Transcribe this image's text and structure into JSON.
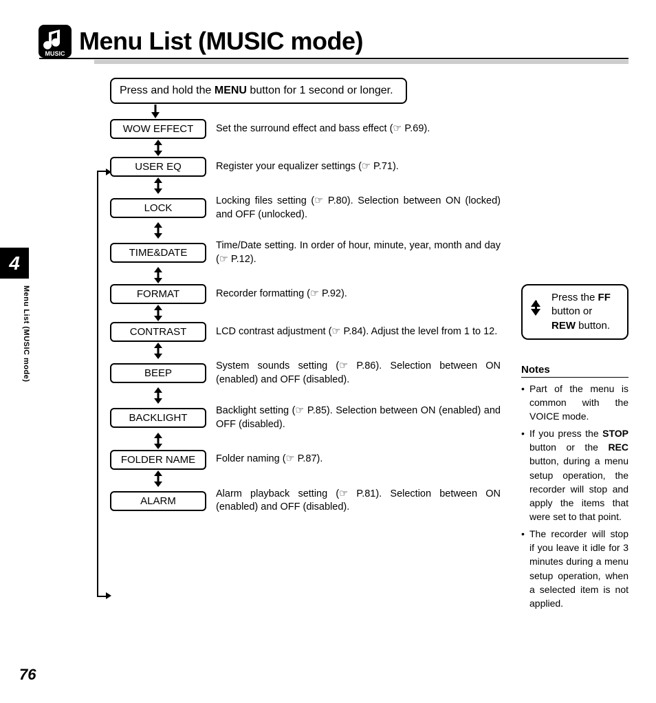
{
  "header": {
    "icon_label": "MUSIC",
    "title": "Menu List (MUSIC mode)"
  },
  "intro": {
    "prefix": "Press and hold the ",
    "bold": "MENU",
    "suffix": " button for 1 second or longer."
  },
  "menu": [
    {
      "label": "WOW EFFECT",
      "desc_a": "Set the surround effect and bass effect (☞ P.69).",
      "desc_b": ""
    },
    {
      "label": "USER EQ",
      "desc_a": "Register your equalizer settings (☞ P.71).",
      "desc_b": ""
    },
    {
      "label": "LOCK",
      "desc_a": "Locking files setting (☞ P.80). Selection between ON (locked) and OFF (unlocked).",
      "desc_b": ""
    },
    {
      "label": "TIME&DATE",
      "desc_a": "Time/Date setting. In order of hour, minute, year, month and day (☞ P.12).",
      "desc_b": ""
    },
    {
      "label": "FORMAT",
      "desc_a": "Recorder formatting (☞ P.92).",
      "desc_b": ""
    },
    {
      "label": "CONTRAST",
      "desc_a": "LCD contrast adjustment (☞ P.84). Adjust the level from 1 to 12.",
      "desc_b": ""
    },
    {
      "label": "BEEP",
      "desc_a": "System sounds setting (☞ P.86). Selection between ON (enabled) and OFF (disabled).",
      "desc_b": ""
    },
    {
      "label": "BACKLIGHT",
      "desc_a": "Backlight setting (☞ P.85). Selection between ON (enabled) and OFF (disabled).",
      "desc_b": ""
    },
    {
      "label": "FOLDER NAME",
      "desc_a": "Folder naming (☞ P.87).",
      "desc_b": ""
    },
    {
      "label": "ALARM",
      "desc_a": "Alarm playback setting (☞ P.81). Selection between ON (enabled) and OFF (disabled).",
      "desc_b": ""
    }
  ],
  "nav_hint": {
    "prefix": "Press the ",
    "bold1": "FF",
    "mid": " button or ",
    "bold2": "REW",
    "suffix": " button."
  },
  "notes": {
    "heading": "Notes",
    "items": [
      {
        "plain": "Part of the menu is common with the VOICE mode."
      },
      {
        "pre": "If you press the ",
        "b1": "STOP",
        "mid": " button or the ",
        "b2": "REC",
        "post": " button, during a menu setup operation, the recorder will stop and apply the items that were set to that point."
      },
      {
        "plain": "The recorder will stop if you leave it idle for 3 minutes during a menu setup operation, when a selected item is not applied."
      }
    ]
  },
  "tab": {
    "chapter": "4",
    "side_label": "Menu List (MUSIC mode)"
  },
  "page_number": "76"
}
